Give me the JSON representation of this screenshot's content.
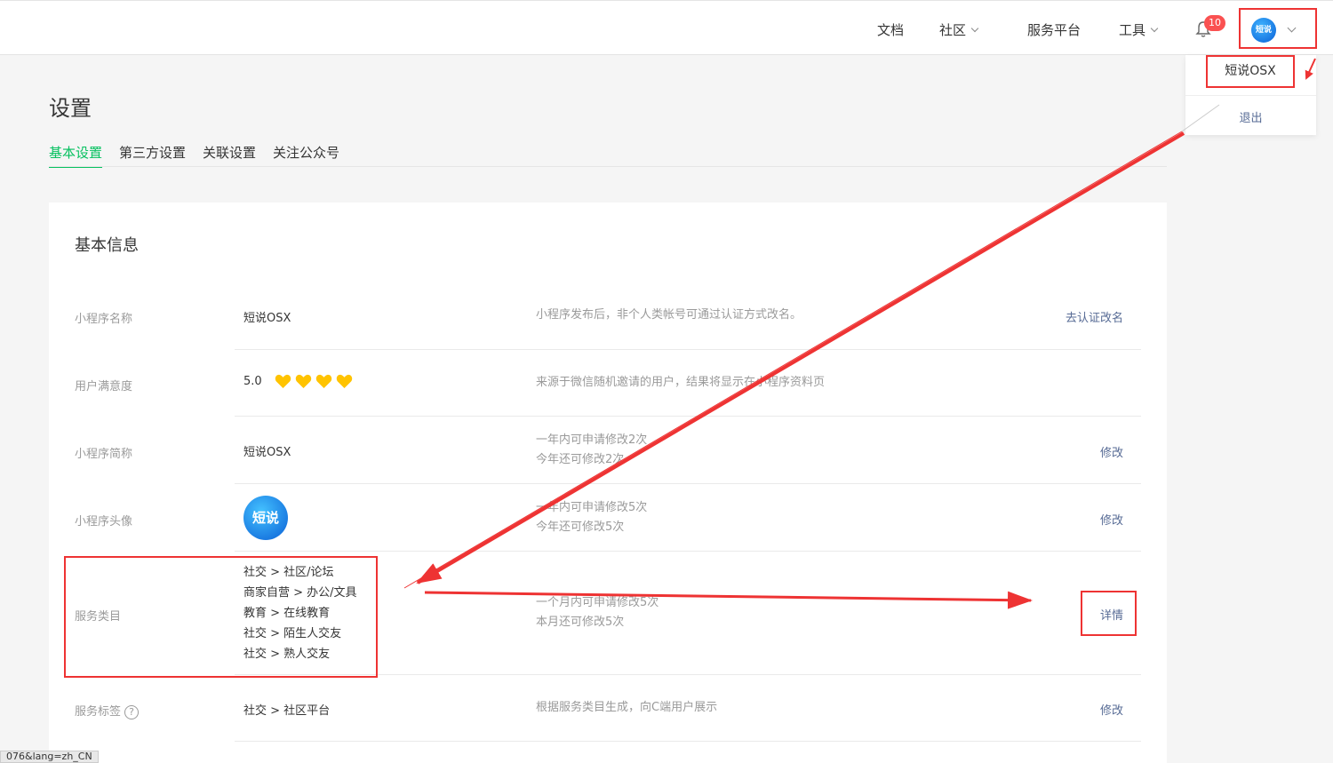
{
  "topbar": {
    "nav": [
      {
        "label": "文档",
        "has_dropdown": false
      },
      {
        "label": "社区",
        "has_dropdown": true
      },
      {
        "label": "服务平台",
        "has_dropdown": false
      },
      {
        "label": "工具",
        "has_dropdown": true
      }
    ],
    "notification_count": "10",
    "avatar_text": "短说"
  },
  "dropdown": {
    "account_name": "短说OSX",
    "logout": "退出"
  },
  "page": {
    "title": "设置",
    "tabs": [
      {
        "label": "基本设置",
        "active": true
      },
      {
        "label": "第三方设置",
        "active": false
      },
      {
        "label": "关联设置",
        "active": false
      },
      {
        "label": "关注公众号",
        "active": false
      }
    ]
  },
  "card": {
    "title": "基本信息",
    "rows": [
      {
        "label": "小程序名称",
        "value": "短说OSX",
        "desc": [
          "小程序发布后，非个人类帐号可通过认证方式改名。"
        ],
        "action": "去认证改名"
      },
      {
        "label": "用户满意度",
        "value": "5.0",
        "rating_hearts": 4,
        "desc": [
          "来源于微信随机邀请的用户，结果将显示在小程序资料页"
        ],
        "action": ""
      },
      {
        "label": "小程序简称",
        "value": "短说OSX",
        "desc": [
          "一年内可申请修改2次",
          "今年还可修改2次"
        ],
        "action": "修改"
      },
      {
        "label": "小程序头像",
        "avatar_text": "短说",
        "desc": [
          "一年内可申请修改5次",
          "今年还可修改5次"
        ],
        "action": "修改"
      },
      {
        "label": "服务类目",
        "categories": [
          "社交 > 社区/论坛",
          "商家自营 > 办公/文具",
          "教育 > 在线教育",
          "社交 > 陌生人交友",
          "社交 > 熟人交友"
        ],
        "desc": [
          "一个月内可申请修改5次",
          "本月还可修改5次"
        ],
        "action": "详情"
      },
      {
        "label": "服务标签",
        "help": "?",
        "value": "社交 > 社区平台",
        "desc": [
          "根据服务类目生成，向C端用户展示"
        ],
        "action": "修改"
      }
    ]
  },
  "status_bar_url": "076&lang=zh_CN",
  "colors": {
    "accent_green": "#07c160",
    "link_blue": "#576b95",
    "highlight_red": "#e33333",
    "badge_red": "#fa5151"
  }
}
